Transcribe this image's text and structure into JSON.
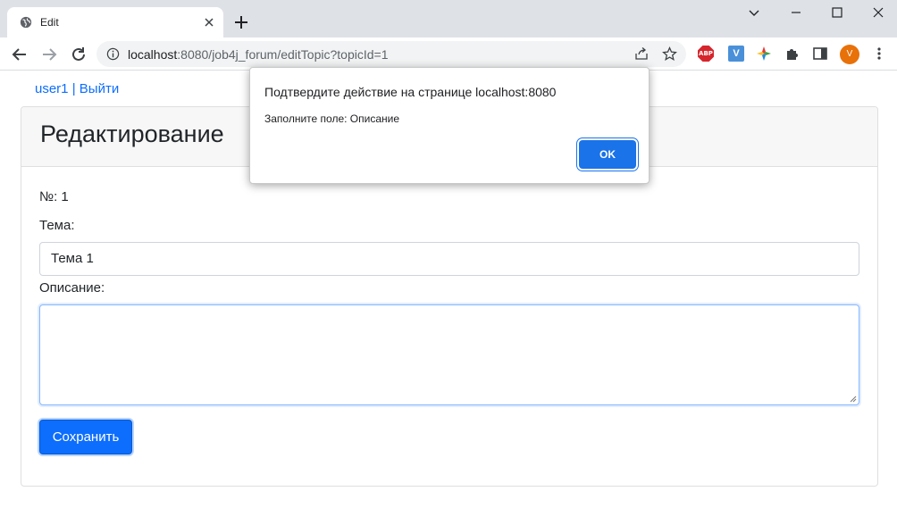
{
  "browser": {
    "tab_title": "Edit",
    "url_host": "localhost",
    "url_rest": ":8080/job4j_forum/editTopic?topicId=1",
    "profile_initial": "V",
    "ext_abp": "ABP",
    "ext_v": "V"
  },
  "page": {
    "user_name": "user1",
    "separator": "|",
    "logout_label": "Выйти",
    "card_title": "Редактирование",
    "number_label": "№: 1",
    "theme_label": "Тема:",
    "theme_value": "Тема 1",
    "description_label": "Описание:",
    "description_value": "",
    "save_label": "Сохранить"
  },
  "dialog": {
    "title": "Подтвердите действие на странице localhost:8080",
    "message": "Заполните поле: Описание",
    "ok_label": "OK"
  }
}
